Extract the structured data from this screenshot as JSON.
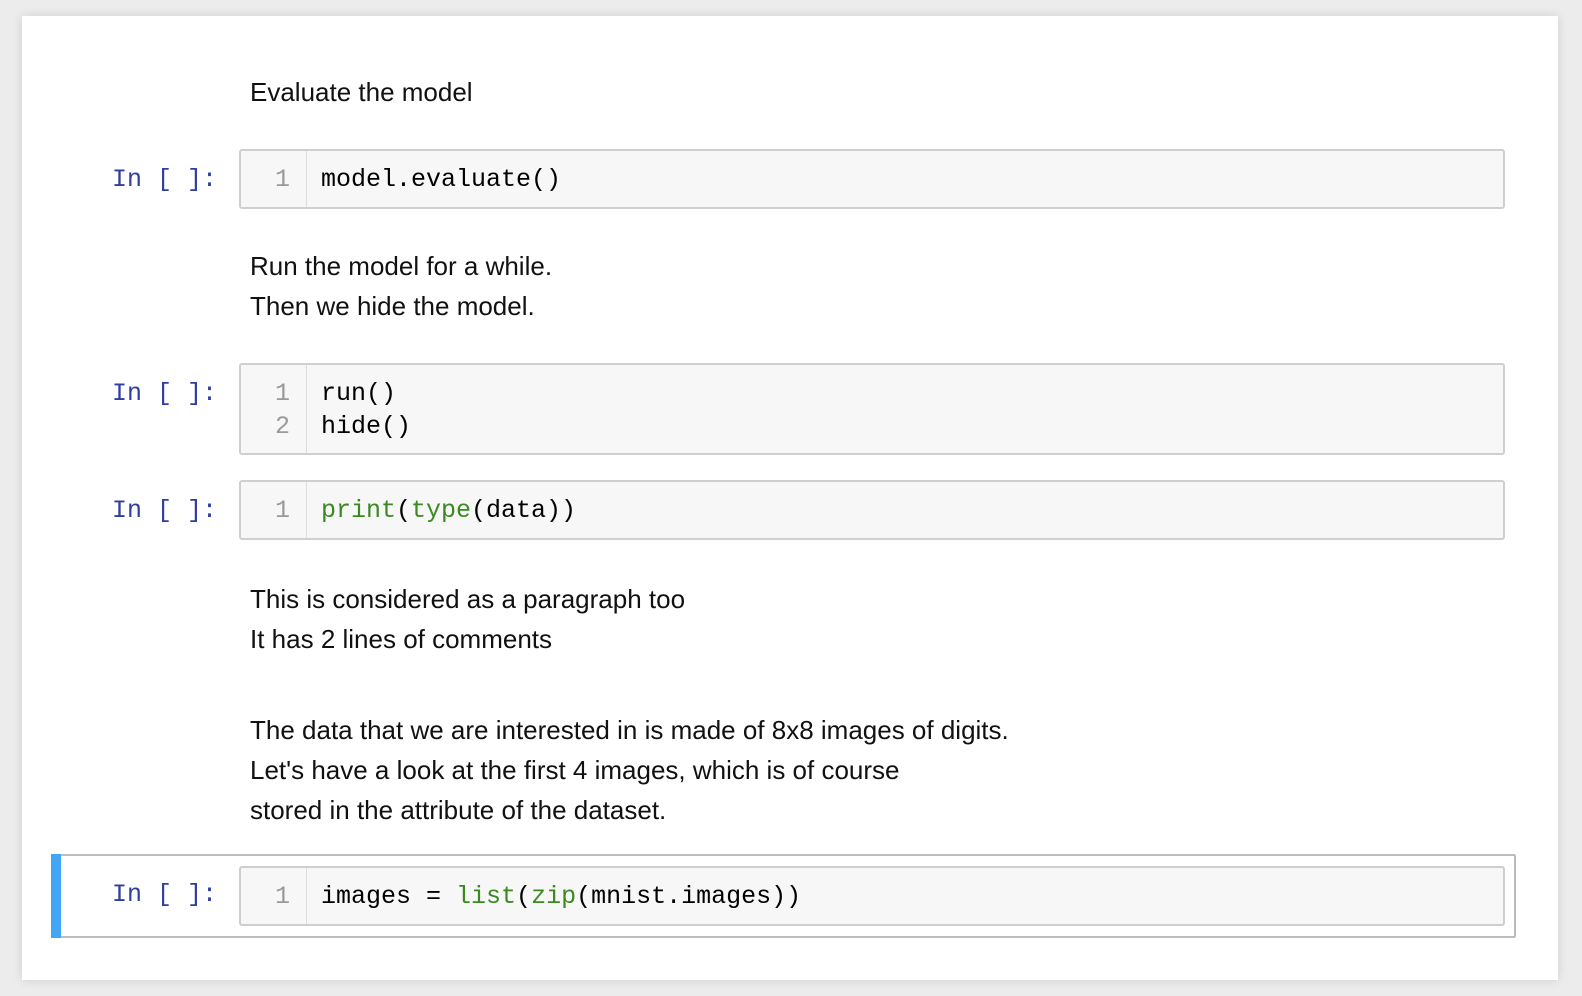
{
  "cells": {
    "md1": {
      "lines": [
        "Evaluate the model"
      ]
    },
    "code1": {
      "prompt": "In [ ]:",
      "lines": [
        {
          "num": "1",
          "text": "model.evaluate()"
        }
      ]
    },
    "md2": {
      "lines": [
        "Run the model for a while.",
        "Then we hide the model."
      ]
    },
    "code2": {
      "prompt": "In [ ]:",
      "lines": [
        {
          "num": "1",
          "text": "run()"
        },
        {
          "num": "2",
          "text": "hide()"
        }
      ]
    },
    "code3": {
      "prompt": "In [ ]:",
      "lines": [
        {
          "num": "1",
          "parts": {
            "fn1": "print",
            "p1": "(",
            "fn2": "type",
            "rest": "(data))"
          }
        }
      ]
    },
    "md3": {
      "lines": [
        "This is considered as a paragraph too",
        "It has 2 lines of comments"
      ]
    },
    "md4": {
      "lines": [
        "The data that we are interested in is made of 8x8 images of digits.",
        "Let's have a look at the first 4 images, which is of course",
        "stored in the attribute of the dataset."
      ]
    },
    "code4": {
      "prompt": "In [ ]:",
      "lines": [
        {
          "num": "1",
          "parts": {
            "pre": "images = ",
            "fn1": "list",
            "p1": "(",
            "fn2": "zip",
            "rest": "(mnist.images))"
          }
        }
      ]
    }
  },
  "colors": {
    "prompt": "#303f9f",
    "builtin": "#3a8a20",
    "selection_bar": "#42a5f5"
  }
}
